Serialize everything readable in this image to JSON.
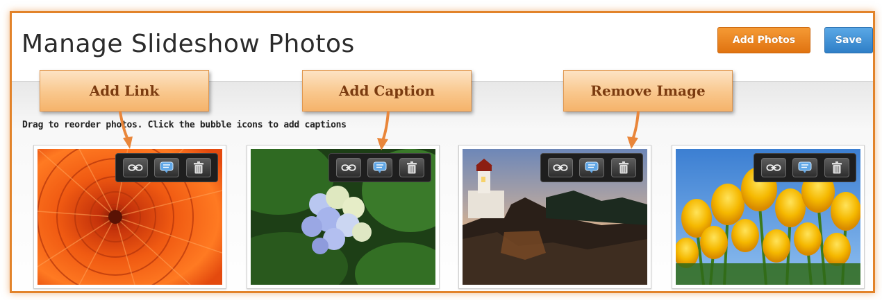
{
  "page": {
    "title": "Manage Slideshow Photos",
    "instructions": "Drag to reorder photos. Click the bubble icons to add captions"
  },
  "buttons": {
    "add_photos": "Add Photos",
    "save": "Save"
  },
  "callouts": {
    "add_link": "Add Link",
    "add_caption": "Add Caption",
    "remove_image": "Remove Image"
  },
  "photos": [
    {
      "subject": "orange chrysanthemum",
      "tools": [
        "link-icon",
        "caption-bubble-icon",
        "trash-icon"
      ]
    },
    {
      "subject": "hydrangea flowers",
      "tools": [
        "link-icon",
        "caption-bubble-icon",
        "trash-icon"
      ]
    },
    {
      "subject": "lighthouse at sunset",
      "tools": [
        "link-icon",
        "caption-bubble-icon",
        "trash-icon"
      ]
    },
    {
      "subject": "yellow tulips",
      "tools": [
        "link-icon",
        "caption-bubble-icon",
        "trash-icon"
      ]
    }
  ],
  "colors": {
    "frame": "#e2832a",
    "add_button": "#e88420",
    "save_button": "#3f8fd5",
    "callout": "#f9c78c",
    "toolbar": "#1e1e1e"
  }
}
